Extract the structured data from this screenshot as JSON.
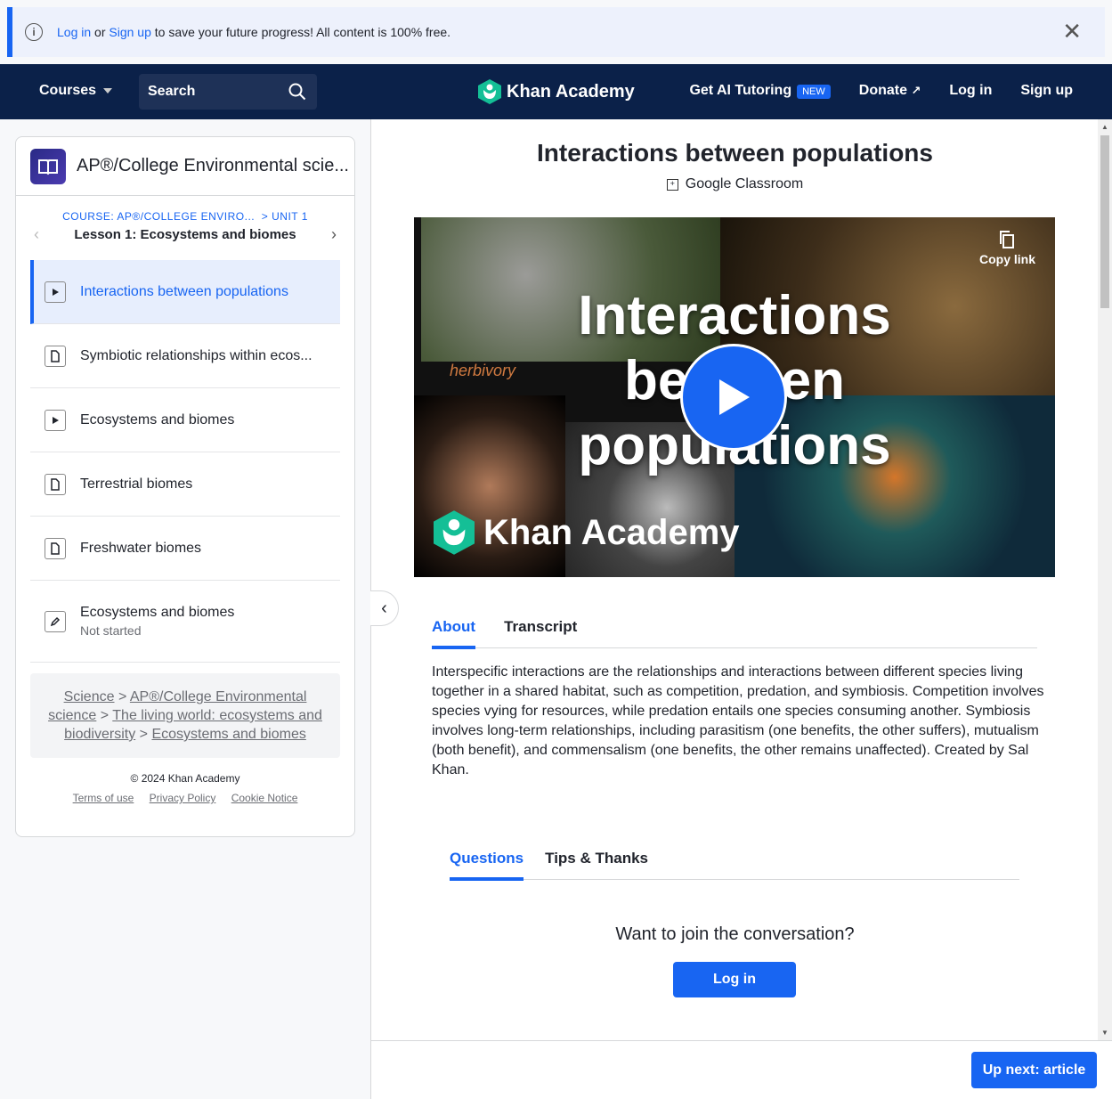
{
  "banner": {
    "login": "Log in",
    "or": " or ",
    "signup": "Sign up",
    "rest": " to save your future progress! All content is 100% free.",
    "close": "✕"
  },
  "nav": {
    "courses": "Courses",
    "search_placeholder": "Search",
    "logo": "Khan Academy",
    "ai": "Get AI Tutoring",
    "new_badge": "NEW",
    "donate": "Donate",
    "login": "Log in",
    "signup": "Sign up"
  },
  "sidebar": {
    "course_title": "AP®/College Environmental scie...",
    "crumb_course": "COURSE: AP®/COLLEGE ENVIRO...",
    "crumb_unit": "UNIT 1",
    "lesson": "Lesson 1: Ecosystems and biomes",
    "items": [
      {
        "label": "Interactions between populations",
        "kind": "video"
      },
      {
        "label": "Symbiotic relationships within ecos...",
        "kind": "article"
      },
      {
        "label": "Ecosystems and biomes",
        "kind": "video"
      },
      {
        "label": "Terrestrial biomes",
        "kind": "article"
      },
      {
        "label": "Freshwater biomes",
        "kind": "article"
      },
      {
        "label": "Ecosystems and biomes",
        "kind": "exercise",
        "status": "Not started"
      }
    ],
    "path": {
      "science": "Science",
      "apes": "AP®/College Environmental science",
      "unit": "The living world: ecosystems and biodiversity",
      "lesson": "Ecosystems and biomes",
      "sep": ">"
    },
    "copyright": "© 2024 Khan Academy",
    "terms": "Terms of use",
    "privacy": "Privacy Policy",
    "cookie": "Cookie Notice"
  },
  "main": {
    "title": "Interactions between populations",
    "google_classroom": "Google Classroom",
    "video": {
      "title_line1": "Interactions",
      "title_line2": "between",
      "title_line3": "populations",
      "copy_link": "Copy link",
      "brand": "Khan Academy",
      "herbivory": "herbivory"
    },
    "tabs": [
      "About",
      "Transcript"
    ],
    "description": "Interspecific interactions are the relationships and interactions between different species living together in a shared habitat, such as competition, predation, and symbiosis. Competition involves species vying for resources, while predation entails one species consuming another. Symbiosis involves long-term relationships, including parasitism (one benefits, the other suffers), mutualism (both benefit), and commensalism (one benefits, the other remains unaffected). Created by Sal Khan.",
    "tabs2": [
      "Questions",
      "Tips & Thanks"
    ],
    "join": "Want to join the conversation?",
    "login_btn": "Log in",
    "up_next": "Up next: article"
  },
  "colors": {
    "accent": "#1865f2",
    "nav_bg": "#0b2149",
    "ka_green": "#14bf96"
  }
}
